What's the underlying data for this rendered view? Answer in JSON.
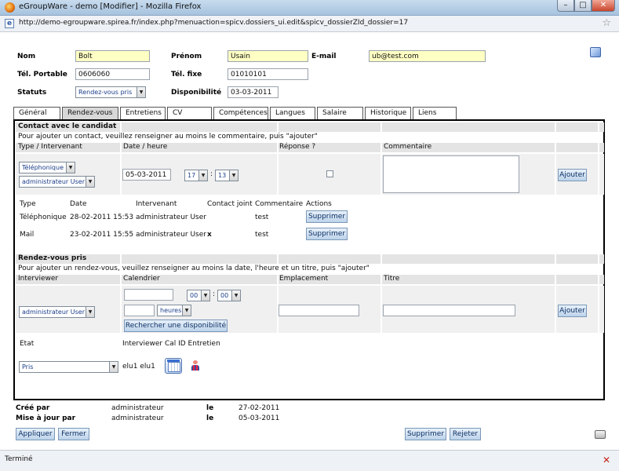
{
  "window": {
    "title": "eGroupWare - demo [Modifier] - Mozilla Firefox",
    "url": "http://demo-egroupware.spirea.fr/index.php?menuaction=spicv.dossiers_ui.edit&spicv_dossierZId_dossier=17",
    "status": "Terminé"
  },
  "form": {
    "nom_label": "Nom",
    "nom_value": "Bolt",
    "prenom_label": "Prénom",
    "prenom_value": "Usain",
    "email_label": "E-mail",
    "email_value": "ub@test.com",
    "tel_portable_label": "Tél. Portable",
    "tel_portable_value": "0606060",
    "tel_fixe_label": "Tél. fixe",
    "tel_fixe_value": "01010101",
    "statuts_label": "Statuts",
    "statuts_value": "Rendez-vous pris",
    "disponibilite_label": "Disponibilité",
    "disponibilite_value": "03-03-2011"
  },
  "tabs": [
    "Général",
    "Rendez-vous",
    "Entretiens",
    "CV",
    "Compétences",
    "Langues",
    "Salaire",
    "Historique",
    "Liens"
  ],
  "active_tab": "Rendez-vous",
  "contact": {
    "title": "Contact avec le candidat",
    "instructions": "Pour ajouter un contact, veuillez renseigner au moins le commentaire, puis \"ajouter\"",
    "headers": [
      "Type / Intervenant",
      "Date / heure",
      "Réponse ?",
      "Commentaire"
    ],
    "type_value": "Téléphonique",
    "intervenant_value": "administrateur User",
    "date_value": "05-03-2011",
    "hour_value": "17",
    "minute_value": "13",
    "time_sep": ":",
    "add_label": "Ajouter",
    "list_headers": [
      "Type",
      "Date",
      "Intervenant",
      "Contact joint",
      "Commentaire",
      "Actions"
    ],
    "rows": [
      {
        "type": "Téléphonique",
        "date": "28-02-2011 15:53",
        "intervenant": "administrateur User",
        "joint": "",
        "commentaire": "test",
        "action": "Supprimer"
      },
      {
        "type": "Mail",
        "date": "23-02-2011 15:55",
        "intervenant": "administrateur User",
        "joint": "x",
        "commentaire": "test",
        "action": "Supprimer"
      }
    ]
  },
  "rdv": {
    "title": "Rendez-vous pris",
    "instructions": "Pour ajouter un rendez-vous, veuillez renseigner au moins la date, l'heure et un titre, puis \"ajouter\"",
    "headers": [
      "Interviewer",
      "Calendrier",
      "Emplacement",
      "Titre"
    ],
    "interviewer_value": "administrateur User",
    "hour_value": "00",
    "minute_value": "00",
    "time_sep": ":",
    "duration_unit": "heures",
    "search_label": "Rechercher une disponibilité",
    "add_label": "Ajouter",
    "list_headers": [
      "Etat",
      "Interviewer Cal ID Entretien"
    ],
    "etat_value": "Pris",
    "interviewer_text": "elu1 elu1"
  },
  "footer": {
    "cree_label": "Créé par",
    "cree_by": "administrateur",
    "le1": "le",
    "cree_date": "27-02-2011",
    "maj_label": "Mise à jour par",
    "maj_by": "administrateur",
    "le2": "le",
    "maj_date": "05-03-2011",
    "apply_label": "Appliquer",
    "close_label": "Fermer",
    "delete_label": "Supprimer",
    "reject_label": "Rejeter"
  },
  "icons": {
    "app": "firefox-icon",
    "book": "book-icon",
    "calendar": "calendar-icon",
    "person": "person-icon",
    "print": "print-icon"
  }
}
